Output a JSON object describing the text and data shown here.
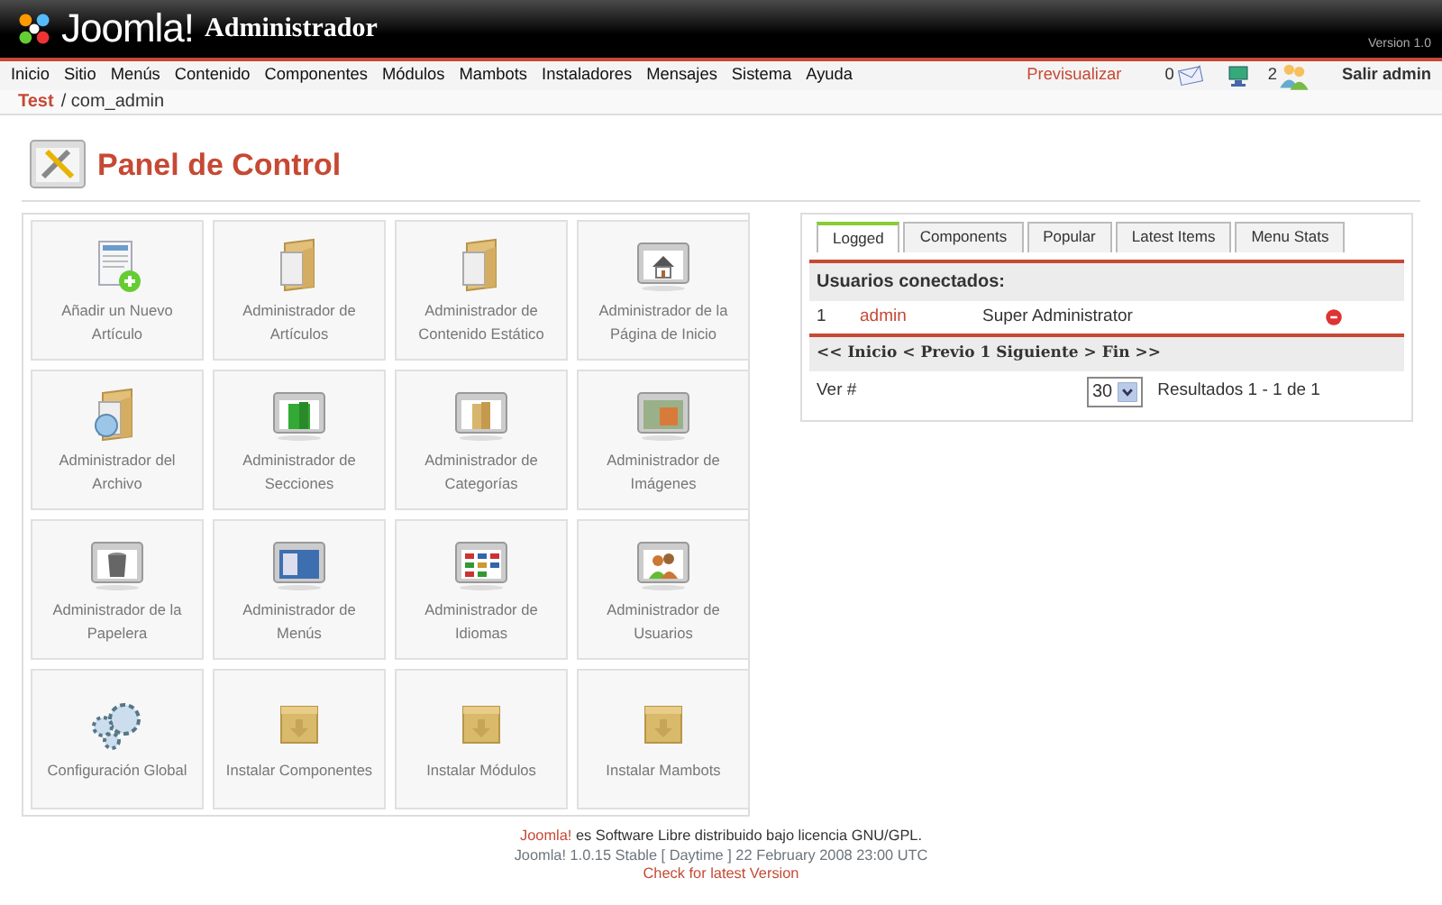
{
  "header": {
    "logo": "Joomla!",
    "title": "Administrador",
    "version": "Version 1.0"
  },
  "menu": [
    "Inicio",
    "Sitio",
    "Menús",
    "Contenido",
    "Componentes",
    "Módulos",
    "Mambots",
    "Instaladores",
    "Mensajes",
    "Sistema",
    "Ayuda"
  ],
  "toolbar": {
    "preview": "Previsualizar",
    "messages": "0",
    "online": "2",
    "logout": "Salir admin"
  },
  "breadcrumb": {
    "home": "Test",
    "current": "/ com_admin"
  },
  "page_title": "Panel de Control",
  "shortcuts": [
    {
      "label": "Añadir un Nuevo Artículo"
    },
    {
      "label": "Administrador de Artículos"
    },
    {
      "label": "Administrador de Contenido Estático"
    },
    {
      "label": "Administrador de la Página de Inicio"
    },
    {
      "label": "Administrador del Archivo"
    },
    {
      "label": "Administrador de Secciones"
    },
    {
      "label": "Administrador de Categorías"
    },
    {
      "label": "Administrador de Imágenes"
    },
    {
      "label": "Administrador de la Papelera"
    },
    {
      "label": "Administrador de Menús"
    },
    {
      "label": "Administrador de Idiomas"
    },
    {
      "label": "Administrador de Usuarios"
    },
    {
      "label": "Configuración Global"
    },
    {
      "label": "Instalar Componentes"
    },
    {
      "label": "Instalar Módulos"
    },
    {
      "label": "Instalar Mambots"
    }
  ],
  "tabs": [
    {
      "label": "Logged",
      "selected": true
    },
    {
      "label": "Components",
      "selected": false
    },
    {
      "label": "Popular",
      "selected": false
    },
    {
      "label": "Latest Items",
      "selected": false
    },
    {
      "label": "Menu Stats",
      "selected": false
    }
  ],
  "logged": {
    "heading": "Usuarios conectados:",
    "rows": [
      {
        "number": "1",
        "user": "admin",
        "group": "Super Administrator"
      }
    ],
    "pagination": "<< Inicio < Previo 1 Siguiente > Fin >>",
    "show_label": "Ver #",
    "limit": "30",
    "results": "Resultados 1 - 1 de 1"
  },
  "footer": {
    "link": "Joomla!",
    "text": "es Software Libre distribuido bajo licencia GNU/GPL.",
    "version": "Joomla! 1.0.15 Stable [ Daytime ] 22 February 2008 23:00 UTC",
    "check": "Check for latest Version"
  }
}
